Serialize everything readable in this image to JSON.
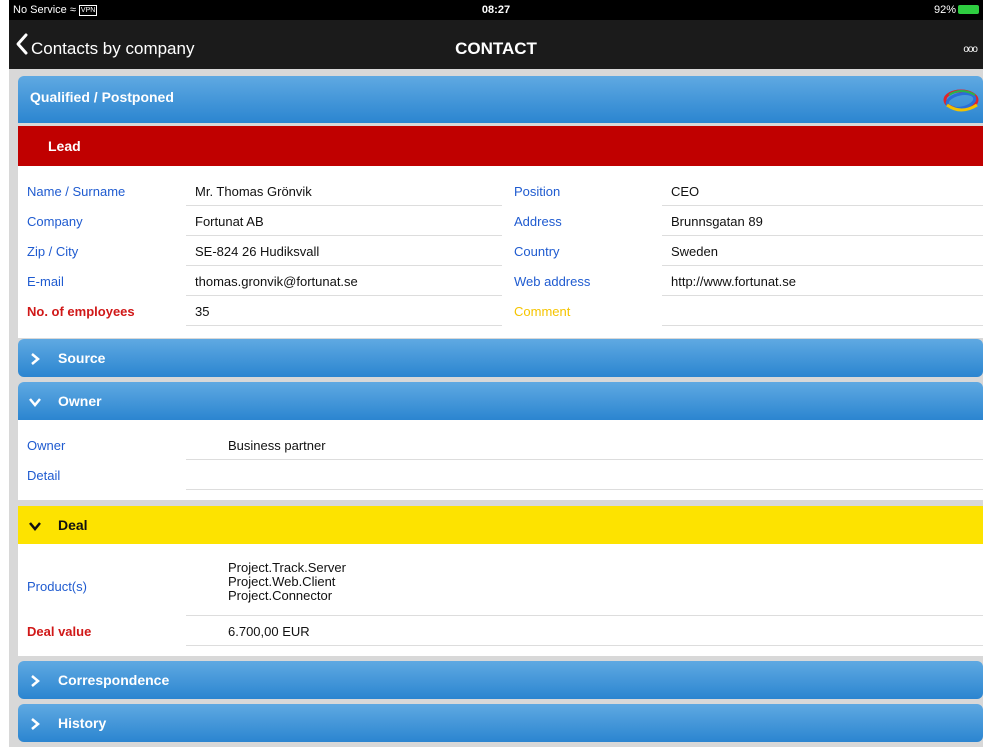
{
  "status_bar": {
    "carrier": "No Service",
    "vpn": "VPN",
    "time": "08:27",
    "battery": "92%"
  },
  "navbar": {
    "back_label": "Contacts by company",
    "title": "CONTACT",
    "more": "ooo"
  },
  "status_header": {
    "label": "Qualified / Postponed"
  },
  "lead_header": {
    "label": "Lead"
  },
  "lead": {
    "left": [
      {
        "label": "Name / Surname",
        "value": "Mr. Thomas Grönvik"
      },
      {
        "label": "Company",
        "value": "Fortunat AB"
      },
      {
        "label": "Zip / City",
        "value": "SE-824 26 Hudiksvall"
      },
      {
        "label": "E-mail",
        "value": "thomas.gronvik@fortunat.se"
      },
      {
        "label": "No. of employees",
        "value": "35"
      }
    ],
    "right": [
      {
        "label": "Position",
        "value": "CEO"
      },
      {
        "label": "Address",
        "value": "Brunnsgatan 89"
      },
      {
        "label": "Country",
        "value": "Sweden"
      },
      {
        "label": "Web address",
        "value": "http://www.fortunat.se"
      },
      {
        "label": "Comment",
        "value": ""
      }
    ]
  },
  "sections": {
    "source": "Source",
    "owner": "Owner",
    "deal": "Deal",
    "correspondence": "Correspondence",
    "history": "History"
  },
  "owner": {
    "owner_label": "Owner",
    "owner_value": "Business partner",
    "detail_label": "Detail",
    "detail_value": ""
  },
  "deal": {
    "products_label": "Product(s)",
    "products": [
      "Project.Track.Server",
      "Project.Web.Client",
      "Project.Connector"
    ],
    "value_label": "Deal value",
    "value": "6.700,00 EUR"
  },
  "colors": {
    "blue_bar": "#2b85d0",
    "lead_red": "#c00000",
    "deal_yellow": "#fde300",
    "label_blue": "#1f5bd0",
    "label_red": "#d01818"
  }
}
